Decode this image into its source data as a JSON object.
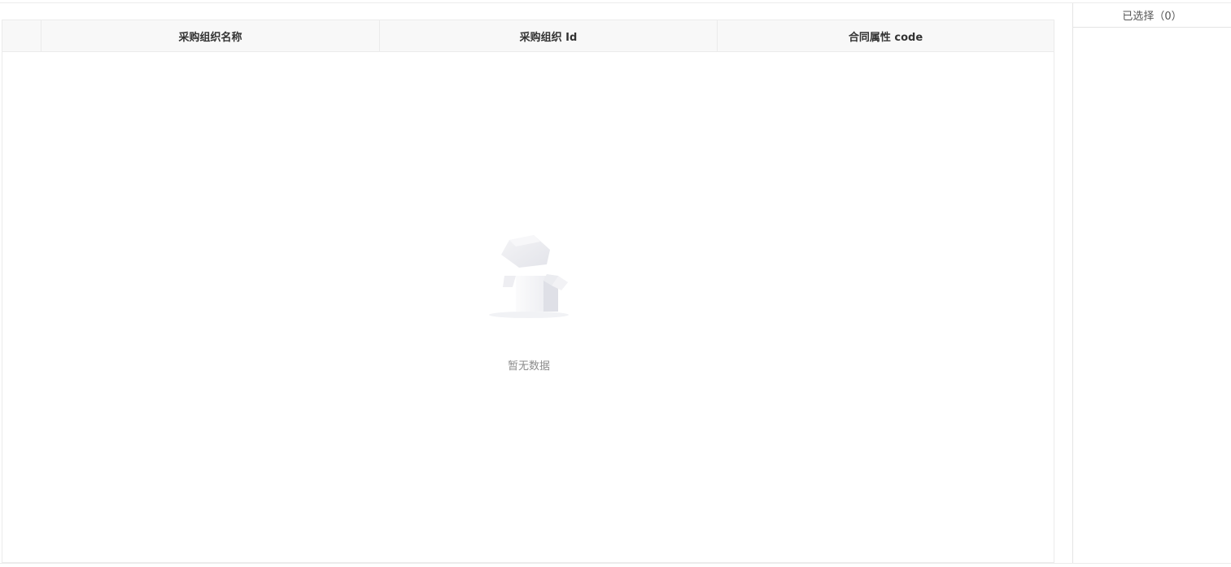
{
  "table": {
    "columns": [
      "",
      "采购组织名称",
      "采购组织 Id",
      "合同属性 code"
    ],
    "rows": [],
    "empty_text": "暂无数据",
    "empty_icon": "empty-box-icon"
  },
  "selected_panel": {
    "title": "已选择（0）"
  },
  "colors": {
    "header_bg": "#f8f8f8",
    "border": "#ebebeb",
    "empty_text": "#8c8c8c"
  }
}
